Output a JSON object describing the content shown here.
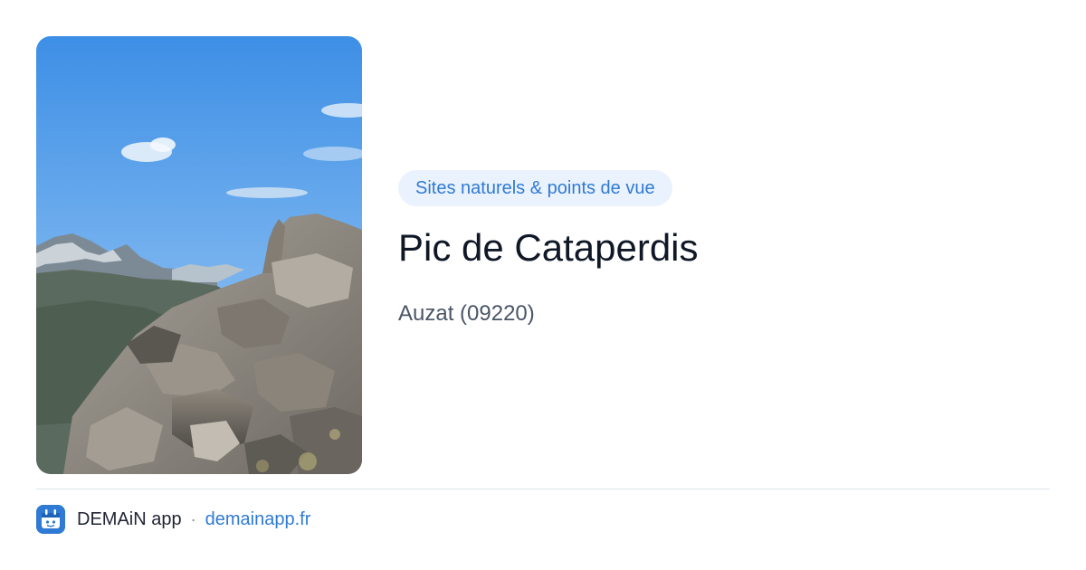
{
  "place": {
    "category": "Sites naturels & points de vue",
    "name": "Pic de Cataperdis",
    "location": "Auzat (09220)"
  },
  "footer": {
    "app_name": "DEMAiN app",
    "separator": "·",
    "url": "demainapp.fr"
  },
  "icons": {
    "app_logo": "demain-app-logo-icon"
  },
  "colors": {
    "accent": "#2f7ad4",
    "badge_bg": "#eaf2fd",
    "title": "#101828",
    "muted": "#4a5567",
    "divider": "#dce5ea"
  }
}
